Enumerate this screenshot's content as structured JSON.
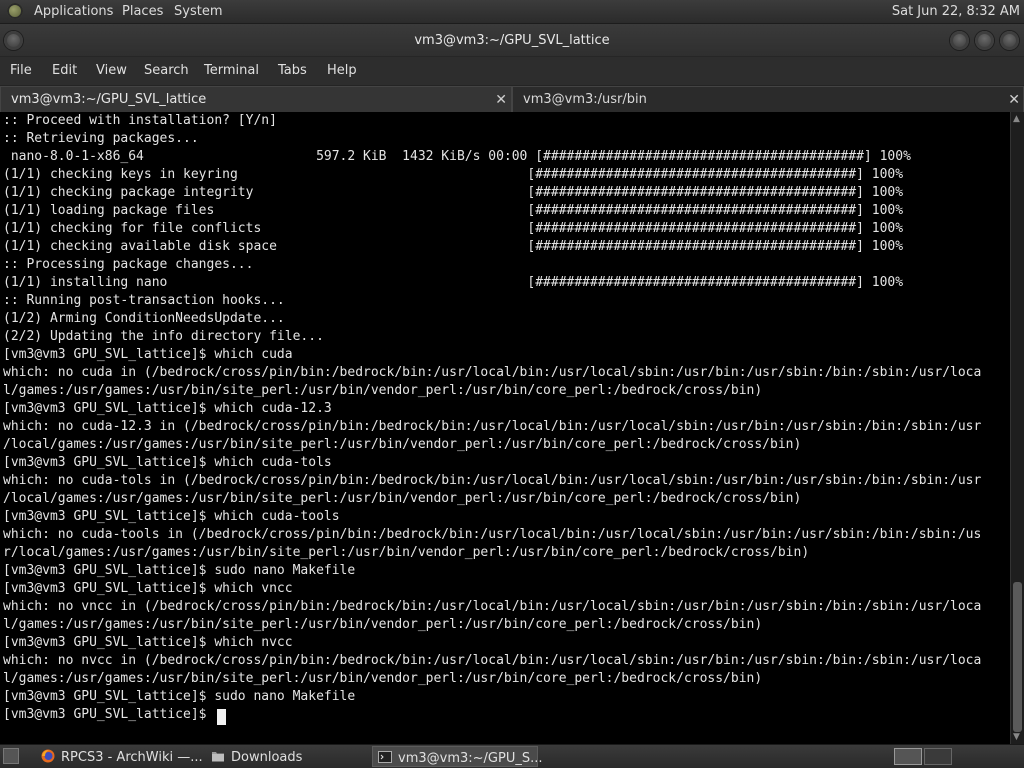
{
  "top_panel": {
    "menus": [
      "Applications",
      "Places",
      "System"
    ],
    "clock": "Sat Jun 22,  8:32 AM"
  },
  "window": {
    "title": "vm3@vm3:~/GPU_SVL_lattice"
  },
  "menubar": [
    "File",
    "Edit",
    "View",
    "Search",
    "Terminal",
    "Tabs",
    "Help"
  ],
  "tabs": [
    {
      "label": "vm3@vm3:~/GPU_SVL_lattice",
      "close": "✕",
      "active": true
    },
    {
      "label": "vm3@vm3:/usr/bin",
      "close": "✕",
      "active": false
    }
  ],
  "terminal": {
    "lines": [
      ":: Proceed with installation? [Y/n]",
      ":: Retrieving packages...",
      " nano-8.0-1-x86_64                      597.2 KiB  1432 KiB/s 00:00 [#########################################] 100%",
      "(1/1) checking keys in keyring                                     [#########################################] 100%",
      "(1/1) checking package integrity                                   [#########################################] 100%",
      "(1/1) loading package files                                        [#########################################] 100%",
      "(1/1) checking for file conflicts                                  [#########################################] 100%",
      "(1/1) checking available disk space                                [#########################################] 100%",
      ":: Processing package changes...",
      "(1/1) installing nano                                              [#########################################] 100%",
      ":: Running post-transaction hooks...",
      "(1/2) Arming ConditionNeedsUpdate...",
      "(2/2) Updating the info directory file...",
      "[vm3@vm3 GPU_SVL_lattice]$ which cuda",
      "which: no cuda in (/bedrock/cross/pin/bin:/bedrock/bin:/usr/local/bin:/usr/local/sbin:/usr/bin:/usr/sbin:/bin:/sbin:/usr/loca",
      "l/games:/usr/games:/usr/bin/site_perl:/usr/bin/vendor_perl:/usr/bin/core_perl:/bedrock/cross/bin)",
      "[vm3@vm3 GPU_SVL_lattice]$ which cuda-12.3",
      "which: no cuda-12.3 in (/bedrock/cross/pin/bin:/bedrock/bin:/usr/local/bin:/usr/local/sbin:/usr/bin:/usr/sbin:/bin:/sbin:/usr",
      "/local/games:/usr/games:/usr/bin/site_perl:/usr/bin/vendor_perl:/usr/bin/core_perl:/bedrock/cross/bin)",
      "[vm3@vm3 GPU_SVL_lattice]$ which cuda-tols",
      "which: no cuda-tols in (/bedrock/cross/pin/bin:/bedrock/bin:/usr/local/bin:/usr/local/sbin:/usr/bin:/usr/sbin:/bin:/sbin:/usr",
      "/local/games:/usr/games:/usr/bin/site_perl:/usr/bin/vendor_perl:/usr/bin/core_perl:/bedrock/cross/bin)",
      "[vm3@vm3 GPU_SVL_lattice]$ which cuda-tools",
      "which: no cuda-tools in (/bedrock/cross/pin/bin:/bedrock/bin:/usr/local/bin:/usr/local/sbin:/usr/bin:/usr/sbin:/bin:/sbin:/us",
      "r/local/games:/usr/games:/usr/bin/site_perl:/usr/bin/vendor_perl:/usr/bin/core_perl:/bedrock/cross/bin)",
      "[vm3@vm3 GPU_SVL_lattice]$ sudo nano Makefile",
      "[vm3@vm3 GPU_SVL_lattice]$ which vncc",
      "which: no vncc in (/bedrock/cross/pin/bin:/bedrock/bin:/usr/local/bin:/usr/local/sbin:/usr/bin:/usr/sbin:/bin:/sbin:/usr/loca",
      "l/games:/usr/games:/usr/bin/site_perl:/usr/bin/vendor_perl:/usr/bin/core_perl:/bedrock/cross/bin)",
      "[vm3@vm3 GPU_SVL_lattice]$ which nvcc",
      "which: no nvcc in (/bedrock/cross/pin/bin:/bedrock/bin:/usr/local/bin:/usr/local/sbin:/usr/bin:/usr/sbin:/bin:/sbin:/usr/loca",
      "l/games:/usr/games:/usr/bin/site_perl:/usr/bin/vendor_perl:/usr/bin/core_perl:/bedrock/cross/bin)",
      "[vm3@vm3 GPU_SVL_lattice]$ sudo nano Makefile",
      "[vm3@vm3 GPU_SVL_lattice]$ "
    ]
  },
  "taskbar": {
    "tasks": [
      {
        "label": "RPCS3 - ArchWiki —...",
        "icon": "firefox-icon",
        "active": false
      },
      {
        "label": "Downloads",
        "icon": "folder-icon",
        "active": false
      },
      {
        "label": "vm3@vm3:~/GPU_S...",
        "icon": "terminal-icon",
        "active": true
      }
    ]
  },
  "colors": {
    "terminal_bg": "#000000",
    "terminal_fg": "#e4e4e4",
    "panel_bg": "#2d2d2d"
  }
}
